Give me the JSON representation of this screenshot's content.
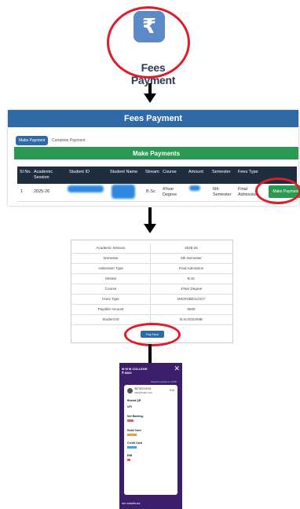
{
  "step1": {
    "icon_symbol": "₹",
    "label": "Fees Payment"
  },
  "step2": {
    "title": "Fees Payment",
    "tabs": [
      "Make Payment",
      "Complete Payment"
    ],
    "section_title": "Make Payments",
    "columns": [
      "Sl No.",
      "Academic Session",
      "Student ID",
      "Student Name",
      "Stream",
      "Course",
      "Amount",
      "Semester",
      "Fees Type"
    ],
    "row": {
      "sl": "1",
      "session": "2025-26",
      "stream": "B.Sc",
      "course": "4Year Degree",
      "semester": "6th Semester",
      "fees_type": "Final Admission"
    },
    "button": "Make Payment"
  },
  "step3": {
    "rows": [
      {
        "k": "Academic Session",
        "v": "2025-26"
      },
      {
        "k": "Semester",
        "v": "6th Semester"
      },
      {
        "k": "Admission Type",
        "v": "Final Admission"
      },
      {
        "k": "Stream",
        "v": "B.Sc"
      },
      {
        "k": "Course",
        "v": "4Year Degree"
      },
      {
        "k": "Hons Type",
        "v": "MICROBIOLOGY"
      },
      {
        "k": "Payable Amount",
        "v": "6600"
      },
      {
        "k": "Student ID",
        "v": "B.Sc/2024/MB"
      }
    ],
    "pay_button": "Pay Now"
  },
  "step4": {
    "college": "M M M COLLEGE",
    "amount": "₹ 6600",
    "session_note": "Session expires in 14:56",
    "phone": "9873XXXX15",
    "email": "xxx@mail.com",
    "edit": "Edit",
    "methods": [
      "Bharat QR",
      "UPI",
      "Net Banking",
      "Debit Card",
      "Credit Card",
      "EMI"
    ],
    "footer": "sm easebuzz"
  },
  "colors": {
    "accent": "#2f6aa6",
    "success": "#2a9a53",
    "highlight": "#e01b2a",
    "gateway": "#3b1f6d"
  }
}
